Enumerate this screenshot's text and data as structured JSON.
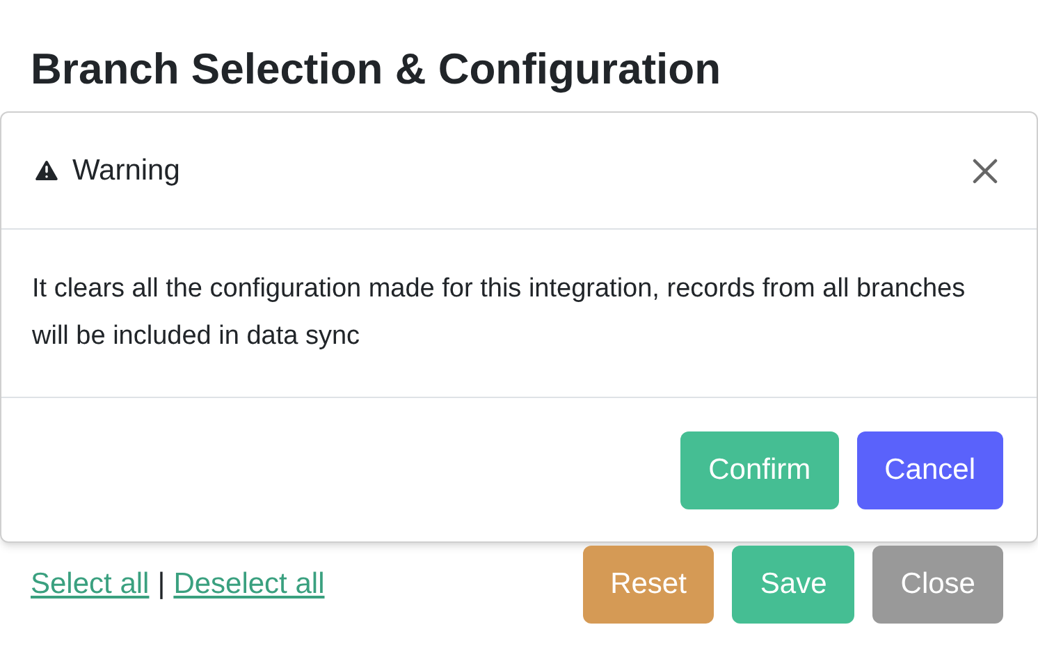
{
  "page": {
    "title": "Branch Selection & Configuration"
  },
  "dialog": {
    "title": "Warning",
    "message": "It clears all the configuration made for this integration, records from all branches will be included in data sync",
    "buttons": [
      {
        "label": "Confirm",
        "kind": "confirm"
      },
      {
        "label": "Cancel",
        "kind": "cancel"
      }
    ]
  },
  "footer": {
    "links": [
      "Select all",
      "Deselect all"
    ],
    "separator": "|",
    "buttons": [
      {
        "label": "Reset",
        "kind": "reset"
      },
      {
        "label": "Save",
        "kind": "save"
      },
      {
        "label": "Close",
        "kind": "close"
      }
    ]
  }
}
